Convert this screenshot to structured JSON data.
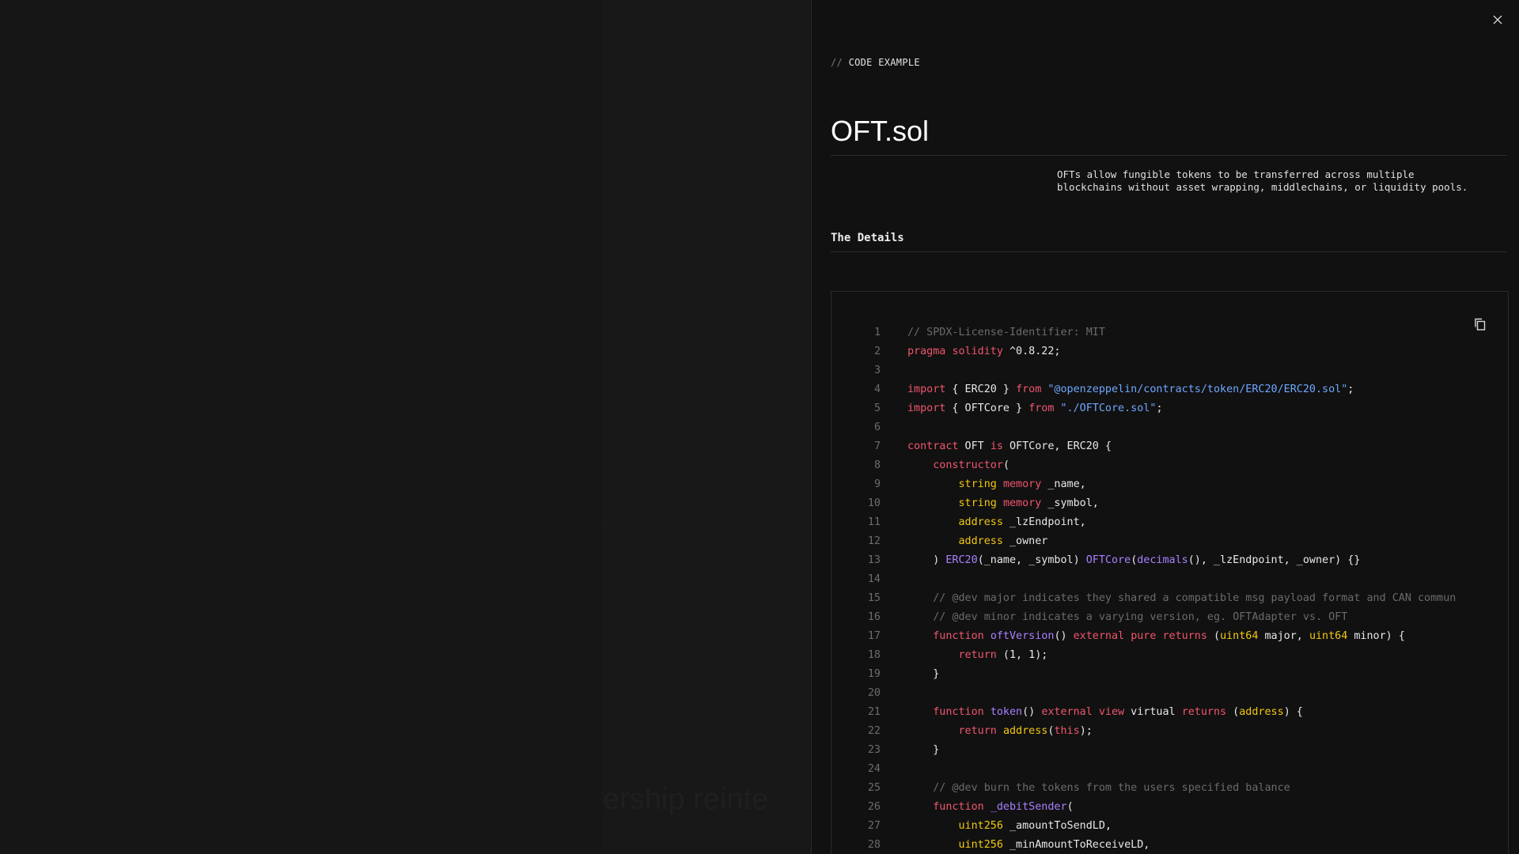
{
  "backdrop": {
    "ghost_heading": "ership reinte",
    "ghost_small": "·—·—"
  },
  "panel": {
    "close_label": "×",
    "eyebrow_slashes": "//",
    "eyebrow_label": "CODE EXAMPLE",
    "title": "OFT.sol",
    "description": "OFTs allow fungible tokens to be transferred across multiple blockchains without asset wrapping, middlechains, or liquidity pools.",
    "details_heading": "The Details",
    "copy_icon": "copy-icon",
    "close_icon": "close-icon"
  },
  "colors": {
    "background": "#111111",
    "keyword": "#f0566e",
    "type": "#f2c811",
    "function": "#a980ff",
    "string": "#6ea7ff",
    "comment": "#6b6b6b",
    "text": "#e8e8e8"
  },
  "code": {
    "language": "solidity",
    "lines": [
      {
        "n": "1",
        "tokens": [
          [
            "comment",
            "// SPDX-License-Identifier: MIT"
          ]
        ]
      },
      {
        "n": "2",
        "tokens": [
          [
            "kw",
            "pragma"
          ],
          [
            "plain",
            " "
          ],
          [
            "kw",
            "solidity"
          ],
          [
            "plain",
            " ^0.8.22;"
          ]
        ]
      },
      {
        "n": "3",
        "tokens": []
      },
      {
        "n": "4",
        "tokens": [
          [
            "kw",
            "import"
          ],
          [
            "plain",
            " { ERC20 } "
          ],
          [
            "kw",
            "from"
          ],
          [
            "plain",
            " "
          ],
          [
            "str",
            "\"@openzeppelin/contracts/token/ERC20/ERC20.sol\""
          ],
          [
            "plain",
            ";"
          ]
        ]
      },
      {
        "n": "5",
        "tokens": [
          [
            "kw",
            "import"
          ],
          [
            "plain",
            " { OFTCore } "
          ],
          [
            "kw",
            "from"
          ],
          [
            "plain",
            " "
          ],
          [
            "str",
            "\"./OFTCore.sol\""
          ],
          [
            "plain",
            ";"
          ]
        ]
      },
      {
        "n": "6",
        "tokens": []
      },
      {
        "n": "7",
        "tokens": [
          [
            "kw",
            "contract"
          ],
          [
            "plain",
            " OFT "
          ],
          [
            "kw",
            "is"
          ],
          [
            "plain",
            " OFTCore, ERC20 {"
          ]
        ]
      },
      {
        "n": "8",
        "tokens": [
          [
            "plain",
            "    "
          ],
          [
            "kw",
            "constructor"
          ],
          [
            "plain",
            "("
          ]
        ]
      },
      {
        "n": "9",
        "tokens": [
          [
            "plain",
            "        "
          ],
          [
            "type",
            "string"
          ],
          [
            "plain",
            " "
          ],
          [
            "kw",
            "memory"
          ],
          [
            "plain",
            " _name,"
          ]
        ]
      },
      {
        "n": "10",
        "tokens": [
          [
            "plain",
            "        "
          ],
          [
            "type",
            "string"
          ],
          [
            "plain",
            " "
          ],
          [
            "kw",
            "memory"
          ],
          [
            "plain",
            " _symbol,"
          ]
        ]
      },
      {
        "n": "11",
        "tokens": [
          [
            "plain",
            "        "
          ],
          [
            "type",
            "address"
          ],
          [
            "plain",
            " _lzEndpoint,"
          ]
        ]
      },
      {
        "n": "12",
        "tokens": [
          [
            "plain",
            "        "
          ],
          [
            "type",
            "address"
          ],
          [
            "plain",
            " _owner"
          ]
        ]
      },
      {
        "n": "13",
        "tokens": [
          [
            "plain",
            "    ) "
          ],
          [
            "fn",
            "ERC20"
          ],
          [
            "plain",
            "(_name, _symbol) "
          ],
          [
            "fn",
            "OFTCore"
          ],
          [
            "plain",
            "("
          ],
          [
            "fn",
            "decimals"
          ],
          [
            "plain",
            "(), _lzEndpoint, _owner) {}"
          ]
        ]
      },
      {
        "n": "14",
        "tokens": []
      },
      {
        "n": "15",
        "tokens": [
          [
            "plain",
            "    "
          ],
          [
            "comment",
            "// @dev major indicates they shared a compatible msg payload format and CAN commun"
          ]
        ]
      },
      {
        "n": "16",
        "tokens": [
          [
            "plain",
            "    "
          ],
          [
            "comment",
            "// @dev minor indicates a varying version, eg. OFTAdapter vs. OFT"
          ]
        ]
      },
      {
        "n": "17",
        "tokens": [
          [
            "plain",
            "    "
          ],
          [
            "kw",
            "function"
          ],
          [
            "plain",
            " "
          ],
          [
            "fn",
            "oftVersion"
          ],
          [
            "plain",
            "() "
          ],
          [
            "kw",
            "external"
          ],
          [
            "plain",
            " "
          ],
          [
            "kw",
            "pure"
          ],
          [
            "plain",
            " "
          ],
          [
            "kw",
            "returns"
          ],
          [
            "plain",
            " ("
          ],
          [
            "type",
            "uint64"
          ],
          [
            "plain",
            " major, "
          ],
          [
            "type",
            "uint64"
          ],
          [
            "plain",
            " minor) {"
          ]
        ]
      },
      {
        "n": "18",
        "tokens": [
          [
            "plain",
            "        "
          ],
          [
            "kw",
            "return"
          ],
          [
            "plain",
            " (1, 1);"
          ]
        ]
      },
      {
        "n": "19",
        "tokens": [
          [
            "plain",
            "    }"
          ]
        ]
      },
      {
        "n": "20",
        "tokens": []
      },
      {
        "n": "21",
        "tokens": [
          [
            "plain",
            "    "
          ],
          [
            "kw",
            "function"
          ],
          [
            "plain",
            " "
          ],
          [
            "fn",
            "token"
          ],
          [
            "plain",
            "() "
          ],
          [
            "kw",
            "external"
          ],
          [
            "plain",
            " "
          ],
          [
            "kw",
            "view"
          ],
          [
            "plain",
            " virtual "
          ],
          [
            "kw",
            "returns"
          ],
          [
            "plain",
            " ("
          ],
          [
            "type",
            "address"
          ],
          [
            "plain",
            ") {"
          ]
        ]
      },
      {
        "n": "22",
        "tokens": [
          [
            "plain",
            "        "
          ],
          [
            "kw",
            "return"
          ],
          [
            "plain",
            " "
          ],
          [
            "type",
            "address"
          ],
          [
            "plain",
            "("
          ],
          [
            "kw",
            "this"
          ],
          [
            "plain",
            ");"
          ]
        ]
      },
      {
        "n": "23",
        "tokens": [
          [
            "plain",
            "    }"
          ]
        ]
      },
      {
        "n": "24",
        "tokens": []
      },
      {
        "n": "25",
        "tokens": [
          [
            "plain",
            "    "
          ],
          [
            "comment",
            "// @dev burn the tokens from the users specified balance"
          ]
        ]
      },
      {
        "n": "26",
        "tokens": [
          [
            "plain",
            "    "
          ],
          [
            "kw",
            "function"
          ],
          [
            "plain",
            " "
          ],
          [
            "fn",
            "_debitSender"
          ],
          [
            "plain",
            "("
          ]
        ]
      },
      {
        "n": "27",
        "tokens": [
          [
            "plain",
            "        "
          ],
          [
            "type",
            "uint256"
          ],
          [
            "plain",
            " _amountToSendLD,"
          ]
        ]
      },
      {
        "n": "28",
        "tokens": [
          [
            "plain",
            "        "
          ],
          [
            "type",
            "uint256"
          ],
          [
            "plain",
            " _minAmountToReceiveLD,"
          ]
        ]
      }
    ]
  }
}
